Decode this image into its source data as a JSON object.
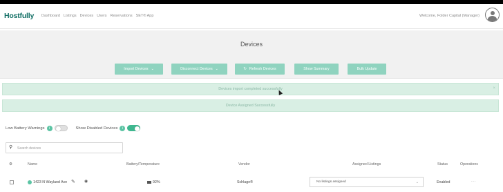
{
  "app": {
    "logo": "Hostfully"
  },
  "nav": {
    "items": [
      "Dashboard",
      "Listings",
      "Devices",
      "Users",
      "Reservations",
      "SET® App"
    ]
  },
  "header": {
    "welcome": "Welcome, Folder Capital (Manager)"
  },
  "page": {
    "title": "Devices"
  },
  "actions": {
    "import_label": "Import Devices",
    "disconnect_label": "Disconnect Devices",
    "refresh_label": "Refresh Devices",
    "summary_label": "Show Summary",
    "bulk_label": "Bulk Update"
  },
  "alerts": [
    {
      "text": "Devices import completed successfully",
      "close": "×"
    },
    {
      "text": "Device Assigned Successfully"
    }
  ],
  "toggles": {
    "low_battery_label": "Low Battery Warnings",
    "low_battery_on": false,
    "show_disabled_label": "Show Disabled Devices",
    "show_disabled_on": true,
    "info_glyph": "i"
  },
  "search": {
    "placeholder": "Search devices",
    "value": ""
  },
  "table": {
    "columns": {
      "name": "Name",
      "battery": "Battery/Temperature",
      "vendor": "Vendor",
      "listings": "Assigned Listings",
      "status": "Status",
      "operations": "Operations"
    },
    "rows": [
      {
        "name": "1423 N Wayland Ave",
        "battery": "92%",
        "vendor": "Schlage®",
        "listings": "No listings assigned",
        "status": "Enabled"
      }
    ]
  },
  "colors": {
    "brand": "#0f6d63",
    "button": "#8fd3bf",
    "alert_bg": "#d9efe4",
    "toggle_on": "#3fb78f"
  },
  "icons": [
    "search-icon",
    "gear-icon",
    "pencil-icon",
    "eye-icon",
    "battery-icon",
    "chevron-down-icon",
    "refresh-icon",
    "user-avatar-icon",
    "close-icon",
    "info-icon",
    "more-icon"
  ]
}
